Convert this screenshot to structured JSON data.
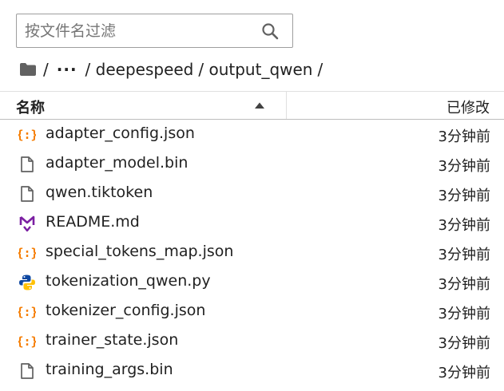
{
  "search": {
    "placeholder": "按文件名过滤"
  },
  "breadcrumb": {
    "root_sep": "/",
    "ellipsis": "···",
    "items": [
      "/ deepespeed",
      "/ output_qwen",
      "/"
    ]
  },
  "table": {
    "col_name": "名称",
    "col_modified": "已修改",
    "sort": "ascending"
  },
  "files": [
    {
      "name": "adapter_config.json",
      "modified": "3分钟前",
      "icon": "json-icon"
    },
    {
      "name": "adapter_model.bin",
      "modified": "3分钟前",
      "icon": "file-icon"
    },
    {
      "name": "qwen.tiktoken",
      "modified": "3分钟前",
      "icon": "file-icon"
    },
    {
      "name": "README.md",
      "modified": "3分钟前",
      "icon": "markdown-icon"
    },
    {
      "name": "special_tokens_map.json",
      "modified": "3分钟前",
      "icon": "json-icon"
    },
    {
      "name": "tokenization_qwen.py",
      "modified": "3分钟前",
      "icon": "python-icon"
    },
    {
      "name": "tokenizer_config.json",
      "modified": "3分钟前",
      "icon": "json-icon"
    },
    {
      "name": "trainer_state.json",
      "modified": "3分钟前",
      "icon": "json-icon"
    },
    {
      "name": "training_args.bin",
      "modified": "3分钟前",
      "icon": "file-icon"
    }
  ],
  "colors": {
    "json": "#f57c00",
    "markdown": "#7b1fa2",
    "python_blue": "#0d47a1",
    "python_yellow": "#ffc107",
    "file_outline": "#616161"
  }
}
